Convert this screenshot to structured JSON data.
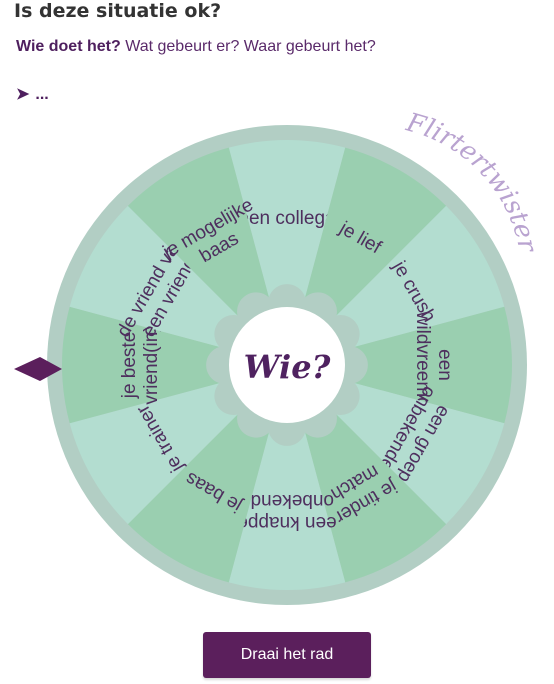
{
  "heading": "Is deze situatie ok?",
  "question": {
    "who": "Wie doet het?",
    "rest": "Wat gebeurt er? Waar gebeurt het?"
  },
  "result": {
    "arrow": "➤",
    "value": "..."
  },
  "wheel": {
    "brand": "Flirtertwister",
    "center_label": "Wie?",
    "segments": [
      [
        "een collega"
      ],
      [
        "je lief"
      ],
      [
        "je crush"
      ],
      [
        "een",
        "wildvreemde"
      ],
      [
        "een groep",
        "onbekenden"
      ],
      [
        "je tinder",
        "match"
      ],
      [
        "een knappe",
        "onbekende"
      ],
      [
        "je baas"
      ],
      [
        "je trainer"
      ],
      [
        "je beste",
        "vriend(in)"
      ],
      [
        "de vriend van",
        "een vriend"
      ],
      [
        "je mogelijke",
        "baas"
      ]
    ],
    "colors": {
      "light": "#b3ddd0",
      "dark": "#9acfb0",
      "rim": "#b2cec4",
      "text": "#4e2f5e",
      "center_text": "#4f2260",
      "brand": "#b9a3d0",
      "pointer": "#5b1f5c"
    }
  },
  "button": {
    "label": "Draai het rad"
  }
}
